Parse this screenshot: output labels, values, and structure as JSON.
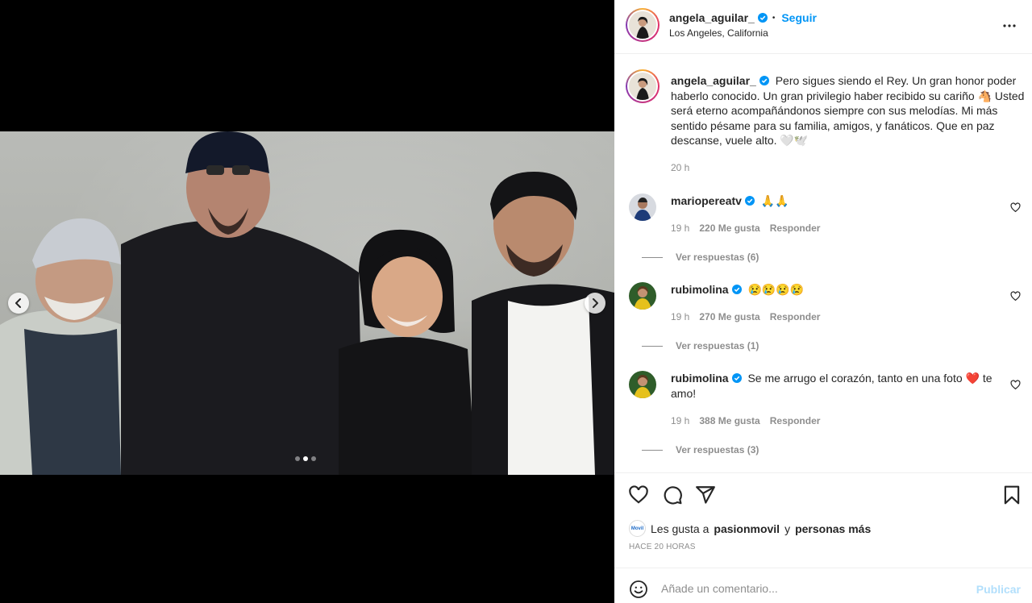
{
  "post": {
    "username": "angela_aguilar_",
    "follow_label": "Seguir",
    "separator": "•",
    "location": "Los Angeles, California",
    "more_icon": "more-horizontal-icon",
    "verified_color": "#0095f6"
  },
  "media": {
    "carousel_dots": 3,
    "active_dot": 2,
    "prev_icon": "chevron-left-icon",
    "next_icon": "chevron-right-icon"
  },
  "caption": {
    "username": "angela_aguilar_",
    "text": "Pero sigues siendo el Rey. Un gran honor poder haberlo conocido. Un gran privilegio haber recibido su cariño 🐴 Usted será eterno acompañándonos siempre con sus melodías. Mi más sentido pésame para su familia, amigos, y fanáticos. Que en paz descanse, vuele alto. 🤍🕊️",
    "time": "20 h"
  },
  "comments": [
    {
      "username": "mariopereatv",
      "text": "🙏🙏",
      "time": "19 h",
      "likes": "220 Me gusta",
      "reply": "Responder",
      "view_replies": "Ver respuestas (6)"
    },
    {
      "username": "rubimolina",
      "text": "😢😢😢😢",
      "time": "19 h",
      "likes": "270 Me gusta",
      "reply": "Responder",
      "view_replies": "Ver respuestas (1)"
    },
    {
      "username": "rubimolina",
      "text": "Se me arrugo el corazón, tanto en una foto ❤️ te amo!",
      "time": "19 h",
      "likes": "388 Me gusta",
      "reply": "Responder",
      "view_replies": "Ver respuestas (3)"
    }
  ],
  "actions": {
    "like_icon": "heart-icon",
    "comment_icon": "comment-bubble-icon",
    "share_icon": "paper-plane-icon",
    "save_icon": "bookmark-icon"
  },
  "likes": {
    "mini_avatar_text": "Movil",
    "prefix": "Les gusta a",
    "user": "pasionmovil",
    "connector": "y",
    "others": "personas más"
  },
  "timestamp": "HACE 20 HORAS",
  "add_comment": {
    "placeholder": "Añade un comentario...",
    "publish_label": "Publicar",
    "emoji_icon": "smiley-icon"
  },
  "colors": {
    "accent": "#0095f6",
    "publish_disabled": "#b2dffc",
    "muted": "#8e8e8e",
    "text": "#262626"
  }
}
